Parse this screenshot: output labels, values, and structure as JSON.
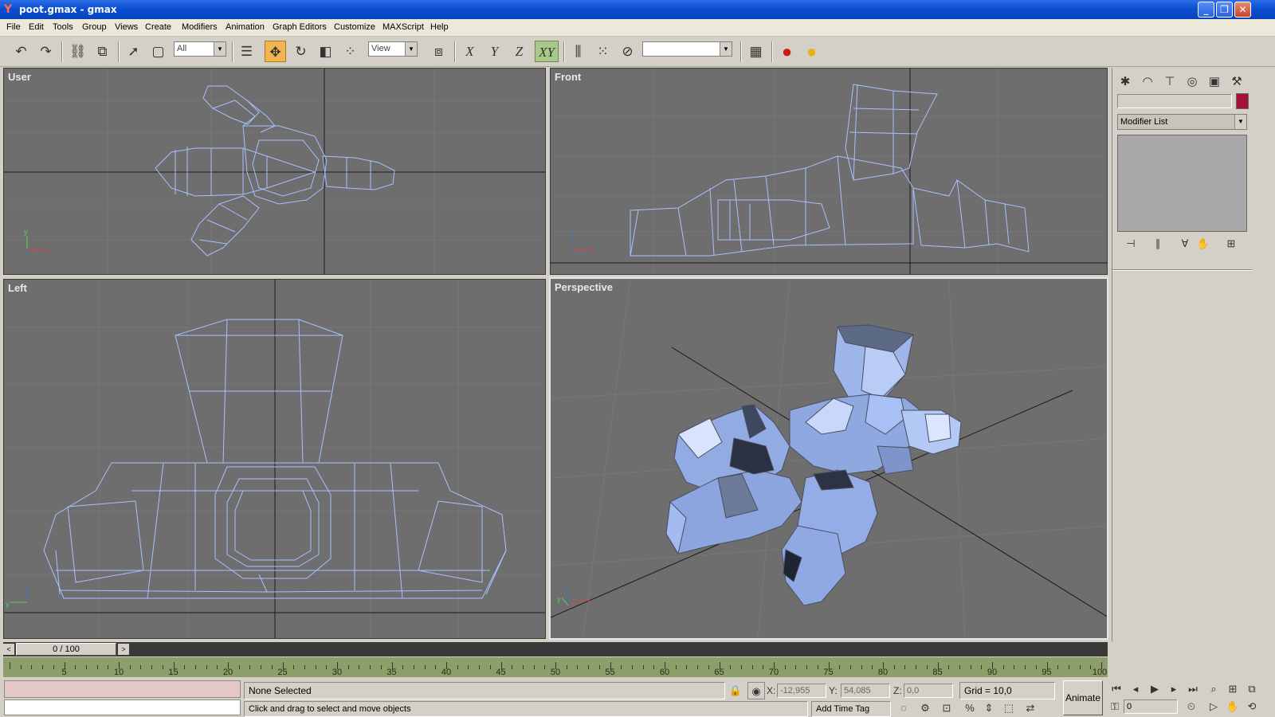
{
  "window": {
    "title": "poot.gmax - gmax"
  },
  "menu": [
    "File",
    "Edit",
    "Tools",
    "Group",
    "Views",
    "Create",
    "Modifiers",
    "Animation",
    "Graph Editors",
    "Customize",
    "MAXScript",
    "Help"
  ],
  "toolbar": {
    "selection_filter": "All",
    "reference_coord": "View",
    "axis_x": "X",
    "axis_y": "Y",
    "axis_z": "Z",
    "axis_xy": "XY",
    "named_selection": ""
  },
  "viewports": {
    "top_left": "User",
    "top_right": "Front",
    "bottom_left": "Left",
    "bottom_right": "Perspective"
  },
  "command_panel": {
    "object_name": "",
    "modifier_list": "Modifier List",
    "color": "#a3123a"
  },
  "time": {
    "slider_label": "0 / 100",
    "ticks": [
      5,
      10,
      15,
      20,
      25,
      30,
      35,
      40,
      45,
      50,
      55,
      60,
      65,
      70,
      75,
      80,
      85,
      90,
      95,
      100
    ]
  },
  "status": {
    "selection": "None Selected",
    "prompt": "Click and drag to select and move objects",
    "x_label": "X:",
    "x_value": "-12,955",
    "y_label": "Y:",
    "y_value": "54,085",
    "z_label": "Z:",
    "z_value": "0,0",
    "grid": "Grid = 10,0",
    "add_time_tag": "Add Time Tag",
    "animate": "Animate",
    "frame": "0"
  },
  "icons": {
    "undo": "undo-icon",
    "redo": "redo-icon",
    "select": "select-arrow-icon",
    "move": "move-icon",
    "rotate": "rotate-icon",
    "scale": "scale-icon",
    "render": "render-teapot-icon"
  }
}
